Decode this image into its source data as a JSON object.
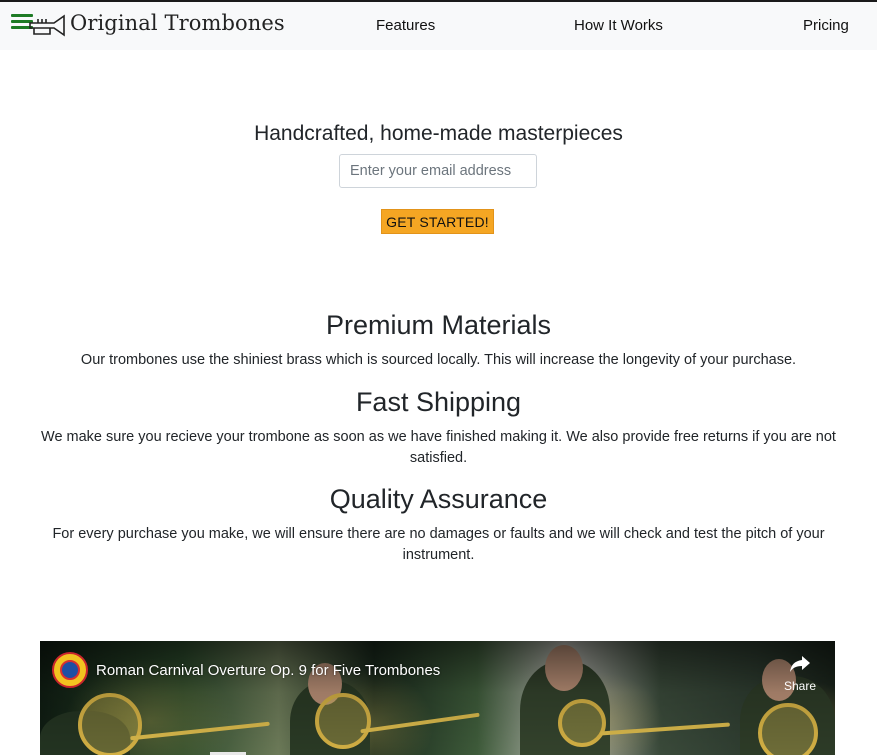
{
  "header": {
    "brand": "Original Trombones",
    "nav": {
      "features": "Features",
      "how_it_works": "How It Works",
      "pricing": "Pricing"
    },
    "icons": {
      "menu": "hamburger-menu-icon",
      "logo": "trumpet-logo-icon"
    }
  },
  "hero": {
    "title": "Handcrafted, home-made masterpieces",
    "email_placeholder": "Enter your email address",
    "email_value": "",
    "cta_label": "GET STARTED!"
  },
  "features": [
    {
      "title": "Premium Materials",
      "text": "Our trombones use the shiniest brass which is sourced locally. This will increase the longevity of your purchase."
    },
    {
      "title": "Fast Shipping",
      "text": "We make sure you recieve your trombone as soon as we have finished making it. We also provide free returns if you are not satisfied."
    },
    {
      "title": "Quality Assurance",
      "text": "For every purchase you make, we will ensure there are no damages or faults and we will check and test the pitch of your instrument."
    }
  ],
  "video": {
    "title": "Roman Carnival Overture Op. 9 for Five Trombones",
    "share_label": "Share",
    "icons": {
      "channel": "channel-avatar-icon",
      "share": "share-arrow-icon"
    }
  },
  "colors": {
    "menu_icon": "#1e7b25",
    "cta_background": "#f5a623",
    "header_background": "#f8f9fa",
    "text": "#212529"
  }
}
